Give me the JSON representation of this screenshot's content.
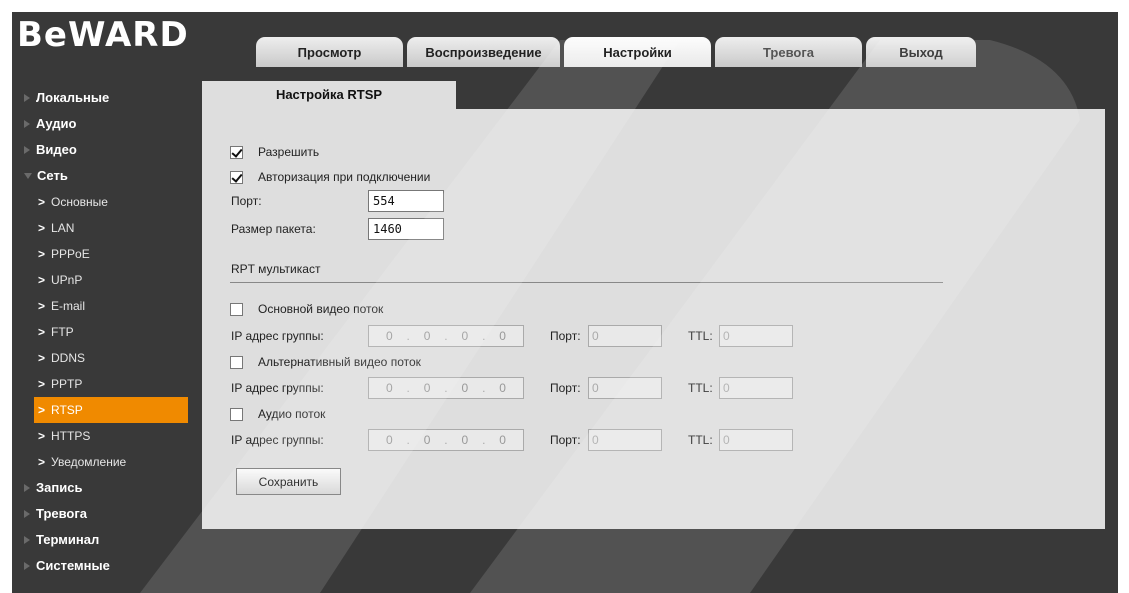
{
  "brand": {
    "logo": "BeWARD"
  },
  "nav_tabs": [
    {
      "label": "Просмотр"
    },
    {
      "label": "Воспроизведение"
    },
    {
      "label": "Настройки"
    },
    {
      "label": "Тревога"
    },
    {
      "label": "Выход"
    }
  ],
  "sidebar": {
    "items": [
      {
        "label": "Локальные"
      },
      {
        "label": "Аудио"
      },
      {
        "label": "Видео"
      },
      {
        "label": "Сеть"
      }
    ],
    "network_sub": [
      {
        "label": "Основные"
      },
      {
        "label": "LAN"
      },
      {
        "label": "PPPoE"
      },
      {
        "label": "UPnP"
      },
      {
        "label": "E-mail"
      },
      {
        "label": "FTP"
      },
      {
        "label": "DDNS"
      },
      {
        "label": "PPTP"
      },
      {
        "label": "RTSP"
      },
      {
        "label": "HTTPS"
      },
      {
        "label": "Уведомление"
      }
    ],
    "items_after": [
      {
        "label": "Запись"
      },
      {
        "label": "Тревога"
      },
      {
        "label": "Терминал"
      },
      {
        "label": "Системные"
      }
    ]
  },
  "panel": {
    "title": "Настройка RTSP",
    "enable_label": "Разрешить",
    "auth_label": "Авторизация при подключении",
    "port_label": "Порт:",
    "port_value": "554",
    "packet_label": "Размер пакета:",
    "packet_value": "1460",
    "multicast_title": "RPT мультикаст",
    "ip_group_label": "IP адрес группы:",
    "port_short": "Порт:",
    "ttl_label": "TTL:",
    "streams": [
      {
        "label": "Основной видео поток",
        "ip": [
          "0",
          "0",
          "0",
          "0"
        ],
        "port": "0",
        "ttl": "0"
      },
      {
        "label": "Альтернативный видео поток",
        "ip": [
          "0",
          "0",
          "0",
          "0"
        ],
        "port": "0",
        "ttl": "0"
      },
      {
        "label": "Аудио поток",
        "ip": [
          "0",
          "0",
          "0",
          "0"
        ],
        "port": "0",
        "ttl": "0"
      }
    ],
    "save_label": "Сохранить"
  }
}
